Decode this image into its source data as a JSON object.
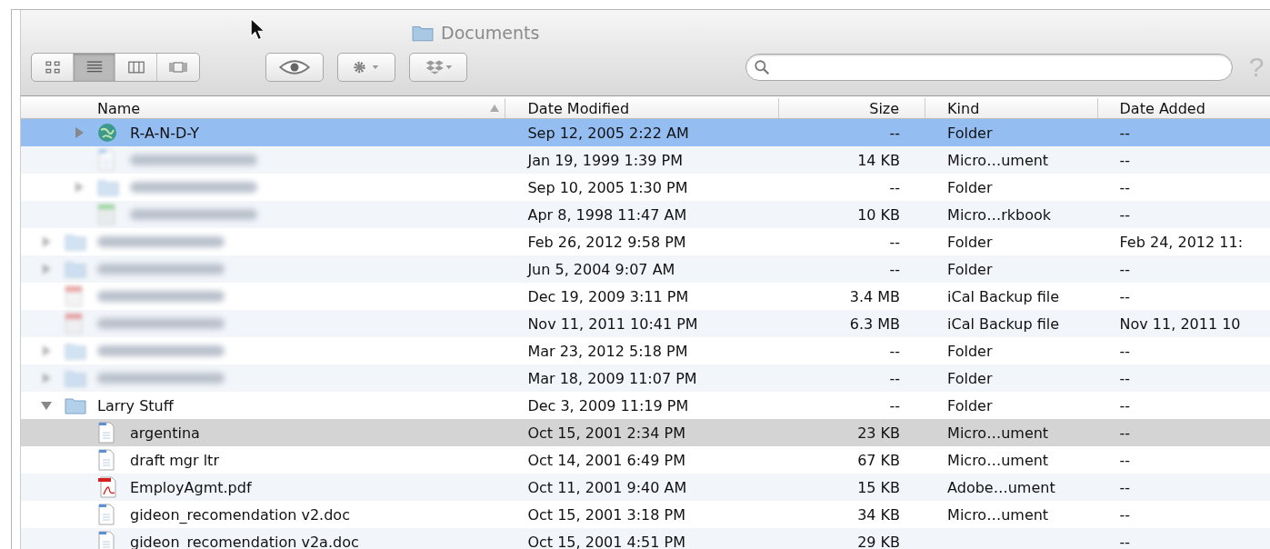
{
  "window": {
    "title": "Documents"
  },
  "toolbar": {
    "view_modes": [
      {
        "selected": false
      },
      {
        "selected": true
      },
      {
        "selected": false
      },
      {
        "selected": false
      }
    ],
    "help": "?"
  },
  "table": {
    "columns": [
      "Name",
      "Date Modified",
      "Size",
      "Kind",
      "Date Added"
    ],
    "rows": [
      {
        "children": [
          {
            "kind": "globe",
            "name": "R-A-N-D-Y",
            "blurred": false,
            "expanded": false,
            "selected": true,
            "highlighted": false,
            "modified": "Sep 12, 2005 2:22 AM",
            "size": "--",
            "kind_label": "Folder",
            "added": "--"
          },
          {
            "kind": "document",
            "blurred": true,
            "selected": false,
            "highlighted": false,
            "modified": "Jan 19, 1999 1:39 PM",
            "size": "14 KB",
            "kind_label": "Micro…ument",
            "added": "--"
          },
          {
            "kind": "folder",
            "blurred": true,
            "expanded": false,
            "selected": false,
            "highlighted": false,
            "modified": "Sep 10, 2005 1:30 PM",
            "size": "--",
            "kind_label": "Folder",
            "added": "--"
          },
          {
            "kind": "spreadsheet",
            "blurred": true,
            "selected": false,
            "highlighted": false,
            "modified": "Apr 8, 1998 11:47 AM",
            "size": "10 KB",
            "kind_label": "Micro…rkbook",
            "added": "--"
          }
        ]
      },
      {
        "kind": "folder",
        "blurred": true,
        "expanded": false,
        "selected": false,
        "highlighted": false,
        "modified": "Feb 26, 2012 9:58 PM",
        "size": "--",
        "kind_label": "Folder",
        "added": "Feb 24, 2012 11:"
      },
      {
        "kind": "folder",
        "blurred": true,
        "expanded": false,
        "selected": false,
        "highlighted": false,
        "modified": "Jun 5, 2004 9:07 AM",
        "size": "--",
        "kind_label": "Folder",
        "added": "--"
      },
      {
        "kind": "calendar",
        "blurred": true,
        "selected": false,
        "highlighted": false,
        "modified": "Dec 19, 2009 3:11 PM",
        "size": "3.4 MB",
        "kind_label": "iCal Backup file",
        "added": "--"
      },
      {
        "kind": "calendar",
        "blurred": true,
        "selected": false,
        "highlighted": false,
        "modified": "Nov 11, 2011 10:41 PM",
        "size": "6.3 MB",
        "kind_label": "iCal Backup file",
        "added": "Nov 11, 2011 10"
      },
      {
        "kind": "folder",
        "blurred": true,
        "expanded": false,
        "selected": false,
        "highlighted": false,
        "modified": "Mar 23, 2012 5:18 PM",
        "size": "--",
        "kind_label": "Folder",
        "added": "--"
      },
      {
        "kind": "folder",
        "blurred": true,
        "expanded": false,
        "selected": false,
        "highlighted": false,
        "modified": "Mar 18, 2009 11:07 PM",
        "size": "--",
        "kind_label": "Folder",
        "added": "--"
      },
      {
        "kind": "folder",
        "name": "Larry Stuff",
        "blurred": false,
        "expanded": true,
        "selected": false,
        "highlighted": false,
        "modified": "Dec 3, 2009 11:19 PM",
        "size": "--",
        "kind_label": "Folder",
        "added": "--",
        "children": [
          {
            "kind": "document",
            "name": "argentina",
            "blurred": false,
            "selected": false,
            "highlighted": true,
            "modified": "Oct 15, 2001 2:34 PM",
            "size": "23 KB",
            "kind_label": "Micro…ument",
            "added": "--"
          },
          {
            "kind": "document",
            "name": "draft mgr ltr",
            "blurred": false,
            "selected": false,
            "highlighted": false,
            "modified": "Oct 14, 2001 6:49 PM",
            "size": "67 KB",
            "kind_label": "Micro…ument",
            "added": "--"
          },
          {
            "kind": "pdf",
            "name": "EmployAgmt.pdf",
            "blurred": false,
            "selected": false,
            "highlighted": false,
            "modified": "Oct 11, 2001 9:40 AM",
            "size": "15 KB",
            "kind_label": "Adobe…ument",
            "added": "--"
          },
          {
            "kind": "document",
            "name": "gideon_recomendation v2.doc",
            "blurred": false,
            "selected": false,
            "highlighted": false,
            "modified": "Oct 15, 2001 3:18 PM",
            "size": "34 KB",
            "kind_label": "Micro…ument",
            "added": "--"
          },
          {
            "kind": "document",
            "name": "gideon_recomendation v2a.doc",
            "blurred": false,
            "selected": false,
            "highlighted": false,
            "modified": "Oct 15, 2001 4:51 PM",
            "size": "29 KB",
            "added": "--"
          }
        ]
      }
    ]
  }
}
